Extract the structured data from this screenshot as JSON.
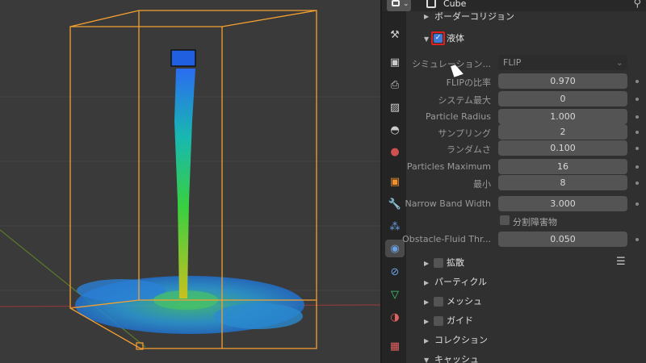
{
  "header": {
    "object_name": "Cube",
    "editor_icon": "properties-editor-icon",
    "pin_icon": "pin-icon"
  },
  "tabs": [
    {
      "name": "tab-tool",
      "icon": "tool-icon",
      "glyph": "🔧"
    },
    {
      "name": "tab-render",
      "icon": "camera-back-icon",
      "glyph": "📷"
    },
    {
      "name": "tab-output",
      "icon": "printer-icon",
      "glyph": "🖨"
    },
    {
      "name": "tab-view-layer",
      "icon": "image-icon",
      "glyph": "🖼"
    },
    {
      "name": "tab-scene",
      "icon": "scene-icon",
      "glyph": "◐"
    },
    {
      "name": "tab-world",
      "icon": "world-icon",
      "glyph": "●"
    },
    {
      "name": "tab-object",
      "icon": "object-icon",
      "glyph": "■"
    },
    {
      "name": "tab-modifier",
      "icon": "wrench-icon",
      "glyph": "🔧"
    },
    {
      "name": "tab-particles",
      "icon": "particles-icon",
      "glyph": "⁂"
    },
    {
      "name": "tab-physics",
      "icon": "physics-icon",
      "glyph": "◉"
    },
    {
      "name": "tab-constraints",
      "icon": "constraint-icon",
      "glyph": "⊘"
    },
    {
      "name": "tab-data",
      "icon": "mesh-data-icon",
      "glyph": "▽"
    },
    {
      "name": "tab-material",
      "icon": "material-icon",
      "glyph": "◑"
    },
    {
      "name": "tab-texture",
      "icon": "texture-icon",
      "glyph": "▦"
    }
  ],
  "sections_top": {
    "border_collisions": "ボーダーコリジョン",
    "liquid": "液体"
  },
  "fields": {
    "simulation_method": {
      "label": "シミュレーション...",
      "value": "FLIP"
    },
    "flip_ratio": {
      "label": "FLIPの比率",
      "value": "0.970"
    },
    "system_max": {
      "label": "システム最大",
      "value": "0"
    },
    "particle_radius": {
      "label": "Particle Radius",
      "value": "1.000"
    },
    "sampling": {
      "label": "サンプリング",
      "value": "2"
    },
    "randomness": {
      "label": "ランダムさ",
      "value": "0.100"
    },
    "particles_maximum": {
      "label": "Particles Maximum",
      "value": "16"
    },
    "minimum": {
      "label": "最小",
      "value": "8"
    },
    "narrow_band_width": {
      "label": "Narrow Band Width",
      "value": "3.000"
    },
    "split_obstacles": {
      "label": "分割障害物"
    },
    "obstacle_fluid_threshold": {
      "label": "Obstacle-Fluid Thr...",
      "value": "0.050"
    }
  },
  "sections_bottom": {
    "diffusion": "拡散",
    "particles": "パーティクル",
    "mesh": "メッシュ",
    "guides": "ガイド",
    "collections": "コレクション",
    "cache": "キャッシュ"
  },
  "colors": {
    "selection_orange": "#f5a030",
    "highlight_red": "#e02020",
    "checkbox_blue": "#3d7bd9"
  }
}
